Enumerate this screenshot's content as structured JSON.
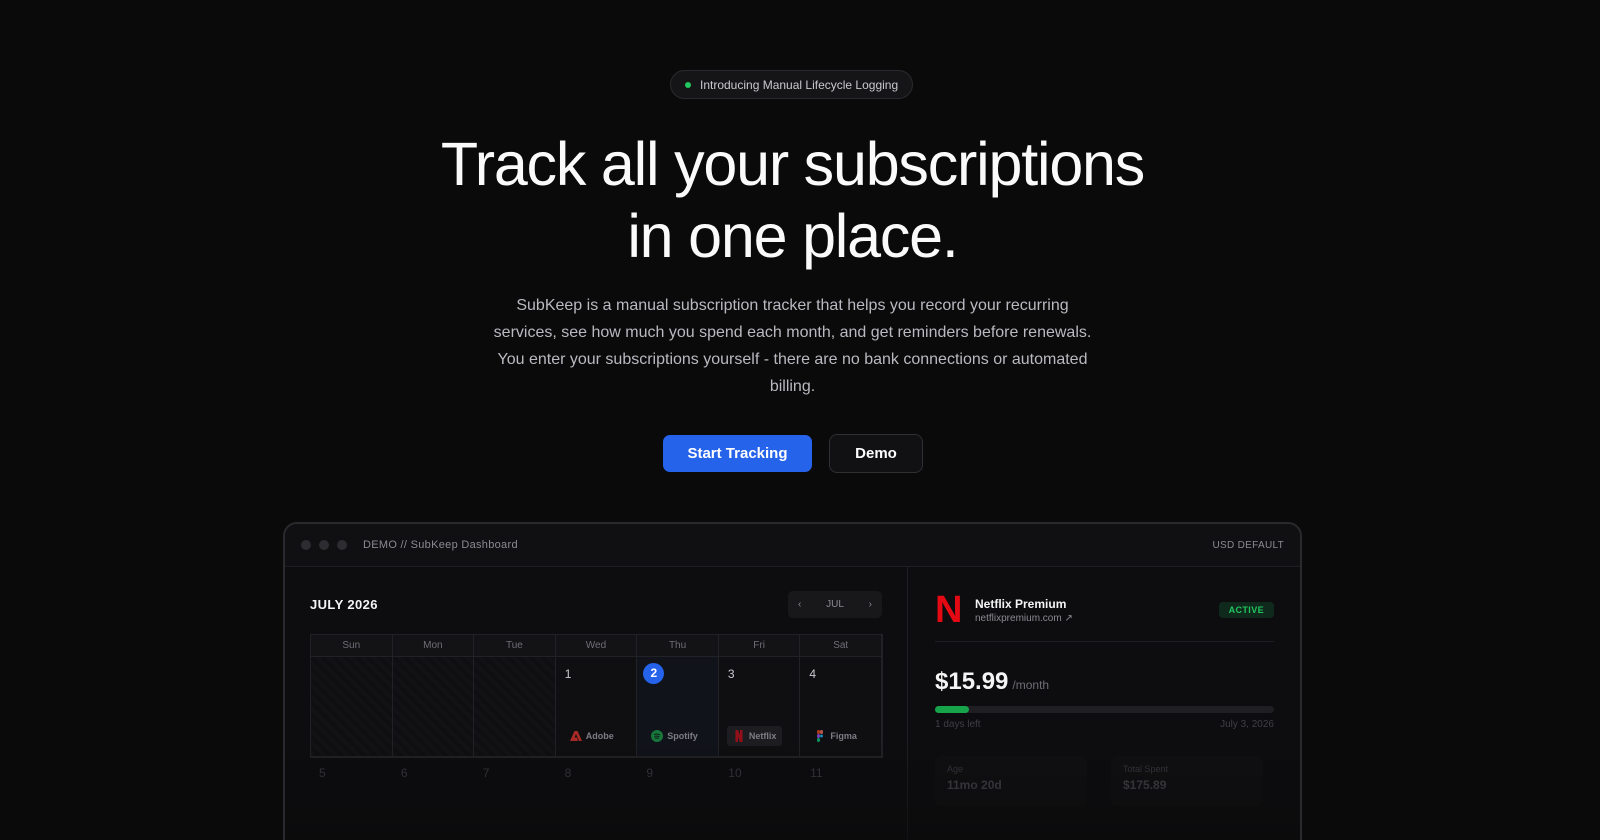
{
  "badge": {
    "text": "Introducing Manual Lifecycle Logging"
  },
  "hero": {
    "title_line1": "Track all your subscriptions",
    "title_line2": "in one place.",
    "description": "SubKeep is a manual subscription tracker that helps you record your recurring services, see how much you spend each month, and get reminders before renewals. You enter your subscriptions yourself - there are no bank connections or automated billing."
  },
  "actions": {
    "primary": "Start Tracking",
    "secondary": "Demo"
  },
  "dashboard": {
    "title": "DEMO // SubKeep Dashboard",
    "currency": "USD DEFAULT",
    "calendar": {
      "month": "JULY 2026",
      "nav_label": "JUL",
      "weekdays": [
        "Sun",
        "Mon",
        "Tue",
        "Wed",
        "Thu",
        "Fri",
        "Sat"
      ],
      "week1": [
        "",
        "",
        "",
        "1",
        "2",
        "3",
        "4"
      ],
      "week2": [
        "5",
        "6",
        "7",
        "8",
        "9",
        "10",
        "11"
      ],
      "chips": {
        "wed": "Adobe",
        "thu": "Spotify",
        "fri": "Netflix",
        "sat": "Figma"
      }
    },
    "detail": {
      "name": "Netflix Premium",
      "url": "netflixpremium.com",
      "status": "ACTIVE",
      "price": "$15.99",
      "period": "/month",
      "progress": 0.1,
      "days_left": "1 days left",
      "renewal_date": "July 3, 2026",
      "stats": [
        {
          "label": "Age",
          "value": "11mo 20d"
        },
        {
          "label": "Total Spent",
          "value": "$175.89"
        }
      ]
    }
  },
  "colors": {
    "accent": "#2563eb",
    "active": "#22c55e",
    "netflix": "#e50914"
  }
}
